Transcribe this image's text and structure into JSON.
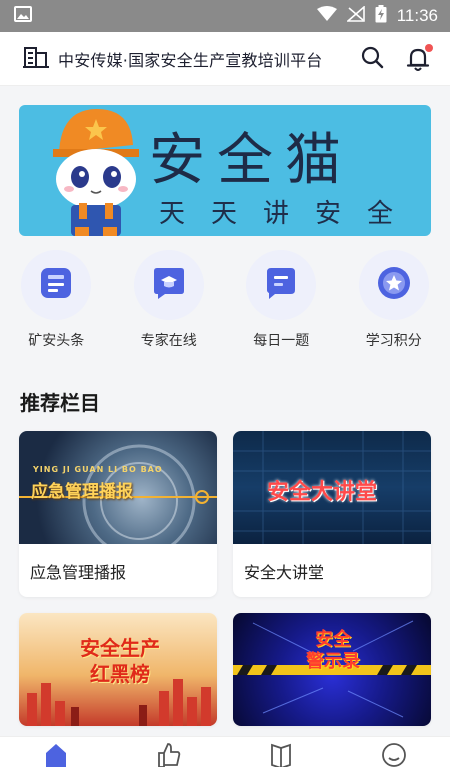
{
  "status_bar": {
    "time": "11:36"
  },
  "header": {
    "title": "中安传媒·国家安全生产宣教培训平台"
  },
  "banner": {
    "title": "安全猫",
    "subtitle": "天天讲安全"
  },
  "quick_nav": [
    {
      "label": "矿安头条",
      "icon": "news-icon"
    },
    {
      "label": "专家在线",
      "icon": "expert-icon"
    },
    {
      "label": "每日一题",
      "icon": "question-icon"
    },
    {
      "label": "学习积分",
      "icon": "points-icon"
    }
  ],
  "section": {
    "title": "推荐栏目"
  },
  "cards": [
    {
      "label": "应急管理播报",
      "thumb_text": "应急管理播报",
      "thumb_sub": "YING JI GUAN LI BO BAO"
    },
    {
      "label": "安全大讲堂",
      "thumb_text": "安全大讲堂"
    },
    {
      "label": "",
      "thumb_text": "安全生产 红黑榜"
    },
    {
      "label": "",
      "thumb_text": "安全 警示录"
    }
  ],
  "tabs": [
    "home-icon",
    "thumb-icon",
    "book-icon",
    "profile-icon"
  ],
  "colors": {
    "accent": "#4d63e0",
    "banner_bg": "#4cbde3",
    "badge": "#f05454"
  }
}
